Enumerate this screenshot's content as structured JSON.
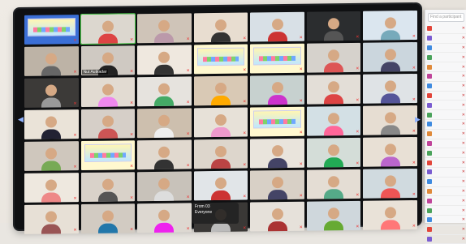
{
  "participants": [
    {
      "name": "",
      "kind": "slide",
      "bg": "#3b6fd6",
      "shirt": "#e33"
    },
    {
      "name": "",
      "kind": "person",
      "bg": "#dcd7cf",
      "shirt": "#d44"
    },
    {
      "name": "",
      "kind": "person",
      "bg": "#cfc4b8",
      "shirt": "#b9a"
    },
    {
      "name": "",
      "kind": "person",
      "bg": "#e8ddd0",
      "shirt": "#333"
    },
    {
      "name": "",
      "kind": "person",
      "bg": "#d8e0e6",
      "shirt": "#c33"
    },
    {
      "name": "",
      "kind": "person",
      "bg": "#2b2d2f",
      "shirt": "#555"
    },
    {
      "name": "",
      "kind": "person",
      "bg": "#dbe6ef",
      "shirt": "#7ab"
    },
    {
      "name": "",
      "kind": "person",
      "bg": "#bdb3a6",
      "shirt": "#666"
    },
    {
      "name": "Nut Autkadar",
      "kind": "person",
      "bg": "#cfc9c2",
      "shirt": "#222"
    },
    {
      "name": "",
      "kind": "person",
      "bg": "#efe8df",
      "shirt": "#333"
    },
    {
      "name": "",
      "kind": "slide",
      "bg": "#fff8cf",
      "shirt": "#e33"
    },
    {
      "name": "",
      "kind": "slide",
      "bg": "#fff8cf",
      "shirt": "#e33"
    },
    {
      "name": "",
      "kind": "person",
      "bg": "#d6d2cc",
      "shirt": "#d55"
    },
    {
      "name": "",
      "kind": "person",
      "bg": "#cbd6dd",
      "shirt": "#446"
    },
    {
      "name": "",
      "kind": "person",
      "bg": "#3c3a38",
      "shirt": "#999"
    },
    {
      "name": "",
      "kind": "person",
      "bg": "#e2dbd2",
      "shirt": "#e8e"
    },
    {
      "name": "",
      "kind": "person",
      "bg": "#e6e3de",
      "shirt": "#4a6"
    },
    {
      "name": "",
      "kind": "person",
      "bg": "#d9c9b5",
      "shirt": "#fa0"
    },
    {
      "name": "",
      "kind": "person",
      "bg": "#c7d1cf",
      "shirt": "#c3c"
    },
    {
      "name": "",
      "kind": "person",
      "bg": "#e3ded7",
      "shirt": "#d44"
    },
    {
      "name": "",
      "kind": "person",
      "bg": "#dfe3e6",
      "shirt": "#559"
    },
    {
      "name": "",
      "kind": "person",
      "bg": "#eae3d8",
      "shirt": "#223"
    },
    {
      "name": "",
      "kind": "person",
      "bg": "#d6cfc8",
      "shirt": "#c55"
    },
    {
      "name": "",
      "kind": "person",
      "bg": "#cdbfae",
      "shirt": "#eee"
    },
    {
      "name": "",
      "kind": "person",
      "bg": "#e7e1d8",
      "shirt": "#e9c"
    },
    {
      "name": "",
      "kind": "slide",
      "bg": "#fff8cf",
      "shirt": "#e33"
    },
    {
      "name": "",
      "kind": "person",
      "bg": "#d3e0e5",
      "shirt": "#f69"
    },
    {
      "name": "",
      "kind": "person",
      "bg": "#e6ddd2",
      "shirt": "#888"
    },
    {
      "name": "",
      "kind": "person",
      "bg": "#cfc7bd",
      "shirt": "#7a5"
    },
    {
      "name": "",
      "kind": "slide",
      "bg": "#fff8cf",
      "shirt": "#e33"
    },
    {
      "name": "",
      "kind": "person",
      "bg": "#e1d9cf",
      "shirt": "#333"
    },
    {
      "name": "",
      "kind": "person",
      "bg": "#ddd6cc",
      "shirt": "#b44"
    },
    {
      "name": "",
      "kind": "person",
      "bg": "#e9e4dc",
      "shirt": "#446"
    },
    {
      "name": "",
      "kind": "person",
      "bg": "#d4ddd8",
      "shirt": "#2a5"
    },
    {
      "name": "",
      "kind": "person",
      "bg": "#e8e0d5",
      "shirt": "#b6c"
    },
    {
      "name": "",
      "kind": "person",
      "bg": "#eee8df",
      "shirt": "#e88"
    },
    {
      "name": "",
      "kind": "person",
      "bg": "#d9d2c9",
      "shirt": "#555"
    },
    {
      "name": "",
      "kind": "person",
      "bg": "#c8c2ba",
      "shirt": "#ddd"
    },
    {
      "name": "",
      "kind": "person",
      "bg": "#e1e5e8",
      "shirt": "#c33"
    },
    {
      "name": "",
      "kind": "person",
      "bg": "#d8d0c6",
      "shirt": "#446"
    },
    {
      "name": "",
      "kind": "person",
      "bg": "#e4ddd4",
      "shirt": "#5a8"
    },
    {
      "name": "",
      "kind": "person",
      "bg": "#d0dadf",
      "shirt": "#e55"
    },
    {
      "name": "",
      "kind": "person",
      "bg": "#e7e0d6",
      "shirt": "#955"
    },
    {
      "name": "",
      "kind": "person",
      "bg": "#d2cbc2",
      "shirt": "#27a"
    },
    {
      "name": "",
      "kind": "person",
      "bg": "#ddd8d1",
      "shirt": "#e2e"
    },
    {
      "name": "",
      "kind": "person",
      "bg": "#3a3836",
      "shirt": "#bbb"
    },
    {
      "name": "",
      "kind": "person",
      "bg": "#e6e1da",
      "shirt": "#a33"
    },
    {
      "name": "",
      "kind": "person",
      "bg": "#cfd7dc",
      "shirt": "#6a3"
    },
    {
      "name": "",
      "kind": "person",
      "bg": "#e9e2d8",
      "shirt": "#f77"
    }
  ],
  "active_index": 1,
  "toast": {
    "line1": "From 03 ",
    "line2": "Everyone"
  },
  "sidebar": {
    "search_placeholder": "Find a participant",
    "items": [
      {
        "name": "",
        "color": "#e2453a"
      },
      {
        "name": "",
        "color": "#7a5cd1"
      },
      {
        "name": "",
        "color": "#3f8be0"
      },
      {
        "name": "",
        "color": "#4aa35b"
      },
      {
        "name": "",
        "color": "#e08a3a"
      },
      {
        "name": "",
        "color": "#c0449a"
      },
      {
        "name": "",
        "color": "#3f8be0"
      },
      {
        "name": "",
        "color": "#e2453a"
      },
      {
        "name": "",
        "color": "#7a5cd1"
      },
      {
        "name": "",
        "color": "#4aa35b"
      },
      {
        "name": "",
        "color": "#3f8be0"
      },
      {
        "name": "",
        "color": "#e08a3a"
      },
      {
        "name": "",
        "color": "#c0449a"
      },
      {
        "name": "",
        "color": "#4aa35b"
      },
      {
        "name": "",
        "color": "#e2453a"
      },
      {
        "name": "",
        "color": "#7a5cd1"
      },
      {
        "name": "",
        "color": "#3f8be0"
      },
      {
        "name": "",
        "color": "#e08a3a"
      },
      {
        "name": "",
        "color": "#c0449a"
      },
      {
        "name": "",
        "color": "#4aa35b"
      },
      {
        "name": "",
        "color": "#3f8be0"
      },
      {
        "name": "",
        "color": "#e2453a"
      },
      {
        "name": "",
        "color": "#7a5cd1"
      }
    ]
  },
  "nav": {
    "prev": "◀",
    "next": "▶"
  }
}
